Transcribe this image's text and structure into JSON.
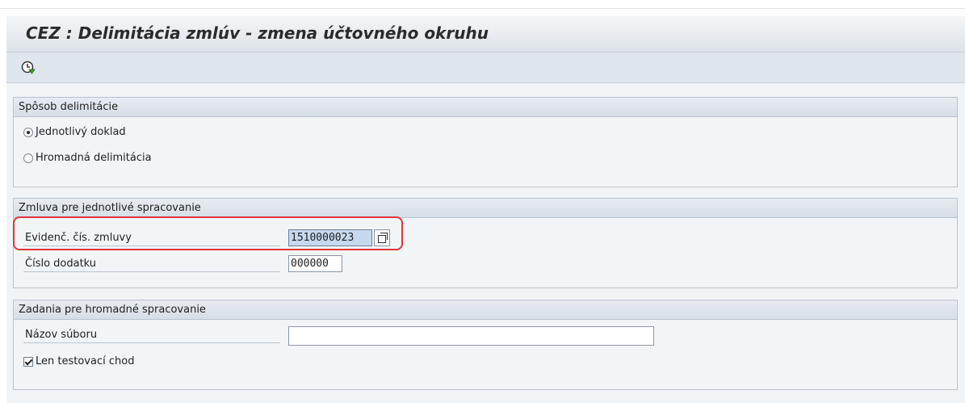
{
  "window": {
    "title": "CEZ : Delimitácia zmlúv - zmena účtovného okruhu"
  },
  "toolbar": {
    "execute_icon": "execute-clock-icon"
  },
  "groups": {
    "method": {
      "header": "Spôsob delimitácie",
      "options": [
        {
          "label": "Jednotlivý doklad",
          "selected": true
        },
        {
          "label": "Hromadná delimitácia",
          "selected": false
        }
      ]
    },
    "single": {
      "header": "Zmluva pre jednotlivé spracovanie",
      "contract_label": "Evidenč. čís. zmluvy",
      "contract_value": "1510000023",
      "amendment_label": "Číslo dodatku",
      "amendment_value": "000000"
    },
    "bulk": {
      "header": "Zadania pre hromadné spracovanie",
      "file_label": "Názov súboru",
      "file_value": "",
      "test_run_label": "Len testovací chod",
      "test_run_checked": true
    }
  },
  "colors": {
    "highlight": "#e0343a",
    "focused_input": "#c6d9ef"
  }
}
